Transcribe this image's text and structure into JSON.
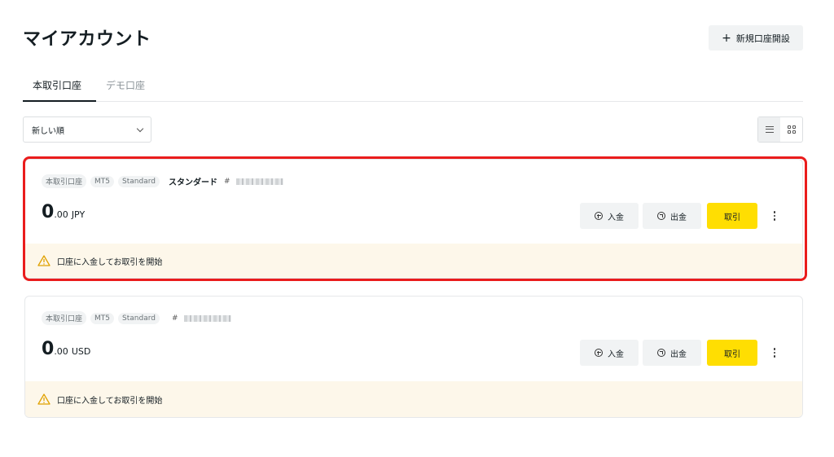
{
  "header": {
    "title": "マイアカウント",
    "new_account_label": "新規口座開設"
  },
  "tabs": [
    {
      "label": "本取引口座",
      "active": true
    },
    {
      "label": "デモ口座",
      "active": false
    }
  ],
  "sort": {
    "selected": "新しい順"
  },
  "accounts": [
    {
      "chips": [
        "本取引口座",
        "MT5",
        "Standard"
      ],
      "name": "スタンダード",
      "hash": "#",
      "balance_int": "0",
      "balance_dec": ".00",
      "currency": "JPY",
      "deposit_label": "入金",
      "withdraw_label": "出金",
      "trade_label": "取引",
      "notice": "口座に入金してお取引を開始",
      "highlighted": true
    },
    {
      "chips": [
        "本取引口座",
        "MT5",
        "Standard"
      ],
      "name": "",
      "hash": "#",
      "balance_int": "0",
      "balance_dec": ".00",
      "currency": "USD",
      "deposit_label": "入金",
      "withdraw_label": "出金",
      "trade_label": "取引",
      "notice": "口座に入金してお取引を開始",
      "highlighted": false
    }
  ],
  "colors": {
    "accent_yellow": "#ffde02",
    "highlight_red": "#ea1c1c",
    "notice_bg": "#fdf7ea"
  },
  "icons": [
    "plus-icon",
    "chevron-down-icon",
    "list-view-icon",
    "grid-view-icon",
    "deposit-icon",
    "withdraw-icon",
    "more-icon",
    "warning-icon"
  ]
}
